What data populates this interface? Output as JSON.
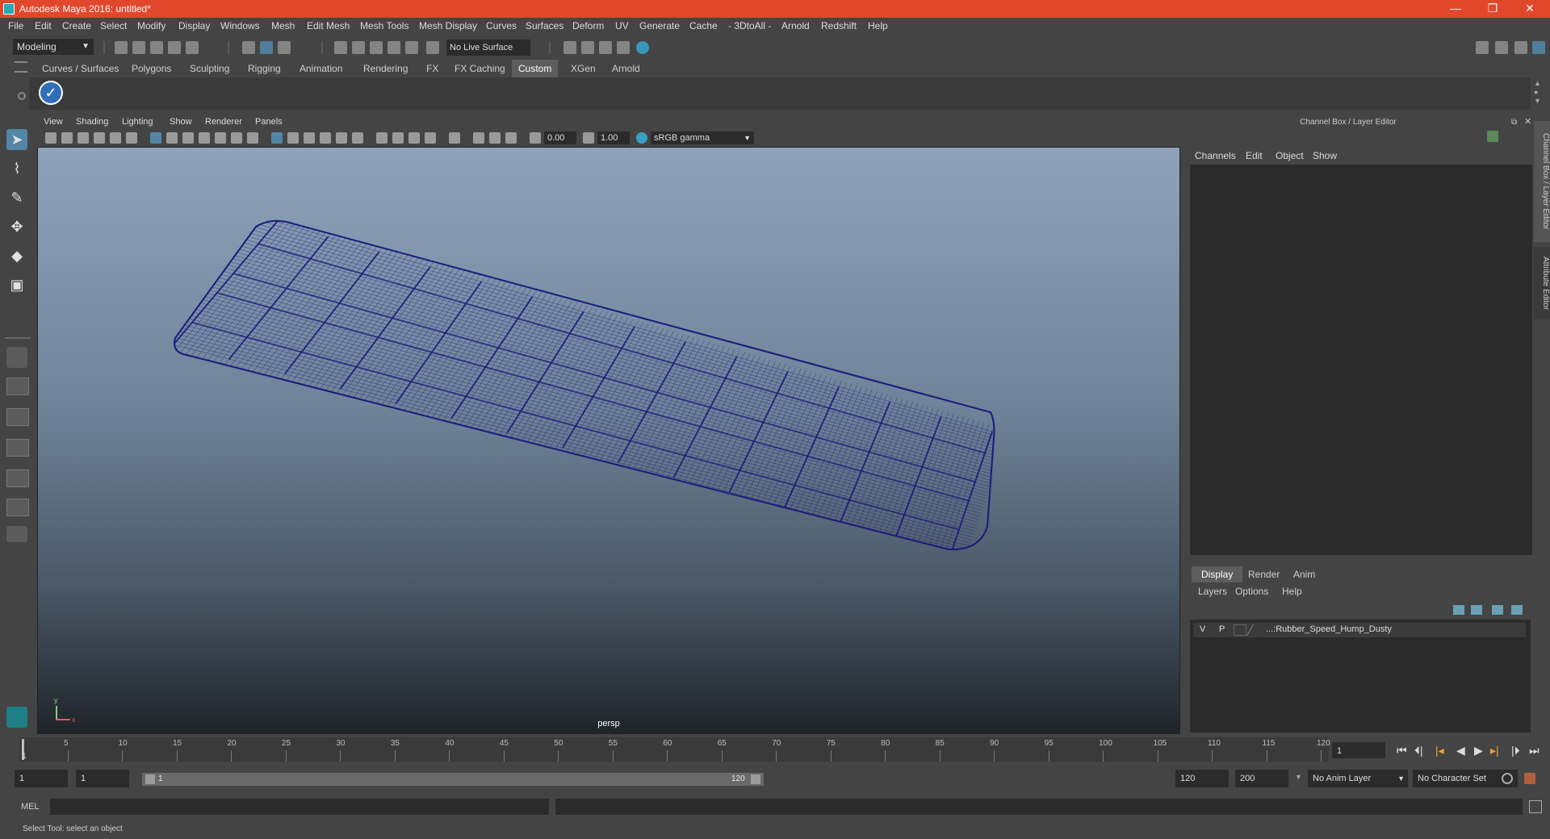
{
  "window": {
    "title": "Autodesk Maya 2016: untitled*",
    "minimize": "—",
    "maximize": "❐",
    "close": "✕"
  },
  "menubar": [
    "File",
    "Edit",
    "Create",
    "Select",
    "Modify",
    "Display",
    "Windows",
    "Mesh",
    "Edit Mesh",
    "Mesh Tools",
    "Mesh Display",
    "Curves",
    "Surfaces",
    "Deform",
    "UV",
    "Generate",
    "Cache",
    "- 3DtoAll -",
    "Arnold",
    "Redshift",
    "Help"
  ],
  "statusline": {
    "mode": "Modeling",
    "live_surface": "No Live Surface"
  },
  "shelf": {
    "tabs": [
      "Curves / Surfaces",
      "Polygons",
      "Sculpting",
      "Rigging",
      "Animation",
      "Rendering",
      "FX",
      "FX Caching",
      "Custom",
      "XGen",
      "Arnold"
    ],
    "active_tab": "Custom"
  },
  "viewport": {
    "menu": [
      "View",
      "Shading",
      "Lighting",
      "Show",
      "Renderer",
      "Panels"
    ],
    "exposure": "0.00",
    "gamma": "1.00",
    "color_space": "sRGB gamma",
    "camera": "persp",
    "wire_color": "#1c1a7a",
    "axis": {
      "x": "x",
      "y": "y"
    }
  },
  "channel_box": {
    "title": "Channel Box / Layer Editor",
    "menu": [
      "Channels",
      "Edit",
      "Object",
      "Show"
    ]
  },
  "layer_editor": {
    "tabs": [
      "Display",
      "Render",
      "Anim"
    ],
    "active_tab": "Display",
    "menu": [
      "Layers",
      "Options",
      "Help"
    ],
    "layers": [
      {
        "v": "V",
        "p": "P",
        "name": "...:Rubber_Speed_Hump_Dusty"
      }
    ]
  },
  "side_tabs": [
    "Channel Box / Layer Editor",
    "Attribute Editor"
  ],
  "timeline": {
    "ticks": [
      "5",
      "10",
      "15",
      "20",
      "25",
      "30",
      "35",
      "40",
      "45",
      "50",
      "55",
      "60",
      "65",
      "70",
      "75",
      "80",
      "85",
      "90",
      "95",
      "100",
      "105",
      "110",
      "115",
      "120"
    ],
    "start_marker": "1",
    "current_frame": "1",
    "range_start": "1",
    "range_start2": "1",
    "range_handle_start": "1",
    "range_handle_end": "120",
    "range_end": "120",
    "anim_end": "200",
    "anim_layer": "No Anim Layer",
    "character_set": "No Character Set"
  },
  "command_line": {
    "label": "MEL"
  },
  "help_line": "Select Tool: select an object"
}
